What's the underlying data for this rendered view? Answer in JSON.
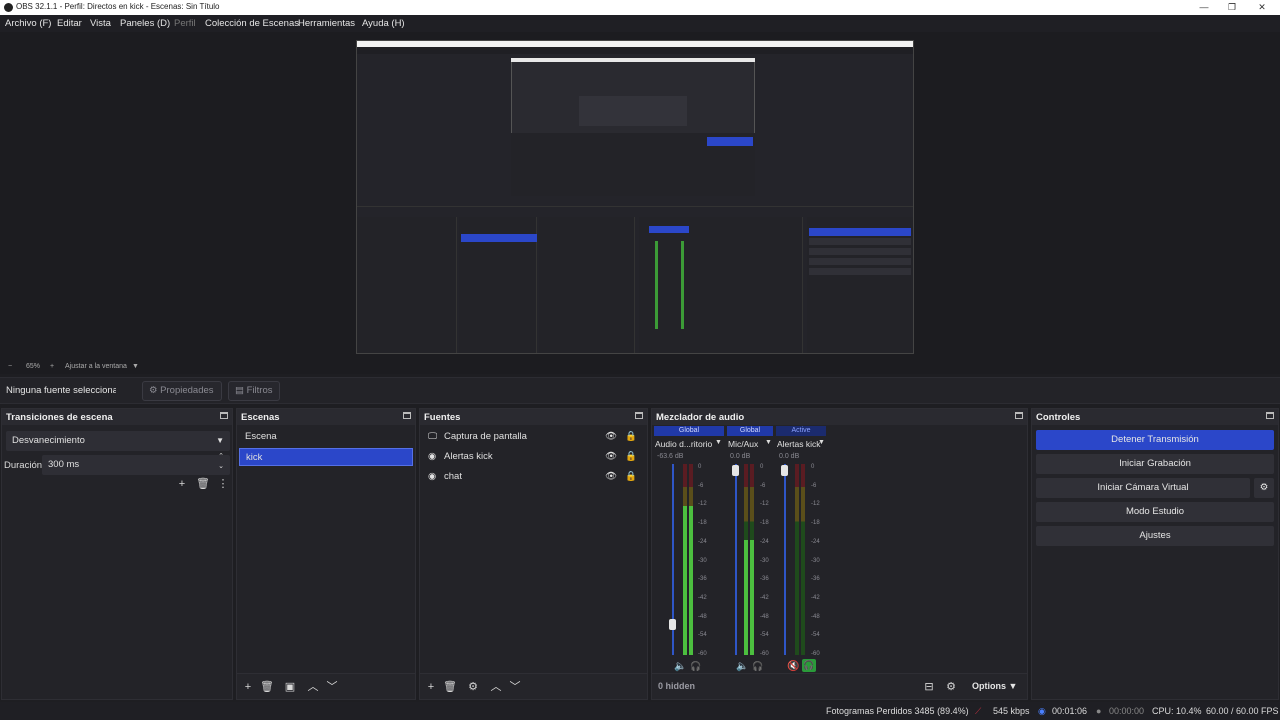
{
  "window": {
    "title": "OBS 32.1.1 - Perfil: Directos en kick - Escenas: Sin Título"
  },
  "menu": {
    "items": [
      "Archivo (F)",
      "Editar",
      "Vista",
      "Paneles (D)",
      "Perfil",
      "Colección de Escenas",
      "Herramientas",
      "Ayuda (H)"
    ]
  },
  "zoom": {
    "minus": "−",
    "value": "65%",
    "plus": "+",
    "fit": "Ajustar a la ventana"
  },
  "source_toolbar": {
    "no_source": "Ninguna fuente seleccionada",
    "properties": "Propiedades",
    "filters": "Filtros"
  },
  "transitions": {
    "title": "Transiciones de escena",
    "selected": "Desvanecimiento",
    "duration_label": "Duración",
    "duration_value": "300 ms"
  },
  "scenes": {
    "title": "Escenas",
    "items": [
      "Escena",
      "kick"
    ],
    "selected_index": 1
  },
  "sources": {
    "title": "Fuentes",
    "items": [
      {
        "label": "Captura de pantalla",
        "icon": "monitor-icon"
      },
      {
        "label": "Alertas kick",
        "icon": "globe-icon"
      },
      {
        "label": "chat",
        "icon": "globe-icon"
      }
    ]
  },
  "mixer": {
    "title": "Mezclador de audio",
    "ticks": [
      "0",
      "-6",
      "-12",
      "-18",
      "-24",
      "-30",
      "-36",
      "-42",
      "-48",
      "-54",
      "-60"
    ],
    "channels": [
      {
        "tag": "Global",
        "name": "Audio d...ritorio",
        "db": "-63.6 dB",
        "level": 0.78
      },
      {
        "tag": "Global",
        "name": "Mic/Aux",
        "db": "0.0 dB",
        "level": 0.6
      },
      {
        "tag": "Active",
        "name": "Alertas kick",
        "db": "0.0 dB",
        "level": 0.0
      }
    ],
    "hidden": "0 hidden",
    "options": "Options"
  },
  "controls": {
    "title": "Controles",
    "stop_stream": "Detener Transmisión",
    "start_record": "Iniciar Grabación",
    "virtual_cam": "Iniciar Cámara Virtual",
    "studio": "Modo Estudio",
    "settings": "Ajustes"
  },
  "status": {
    "dropped": "Fotogramas Perdidos 3485 (89.4%)",
    "bitrate": "545 kbps",
    "stream_time": "00:01:06",
    "rec_time": "00:00:00",
    "cpu": "CPU: 10.4%",
    "fps": "60.00 / 60.00 FPS"
  },
  "colors": {
    "accent": "#2b47c9",
    "meter_green": "#4cbf3f",
    "meter_yellow": "#c8b02a",
    "meter_red": "#b0303a"
  }
}
